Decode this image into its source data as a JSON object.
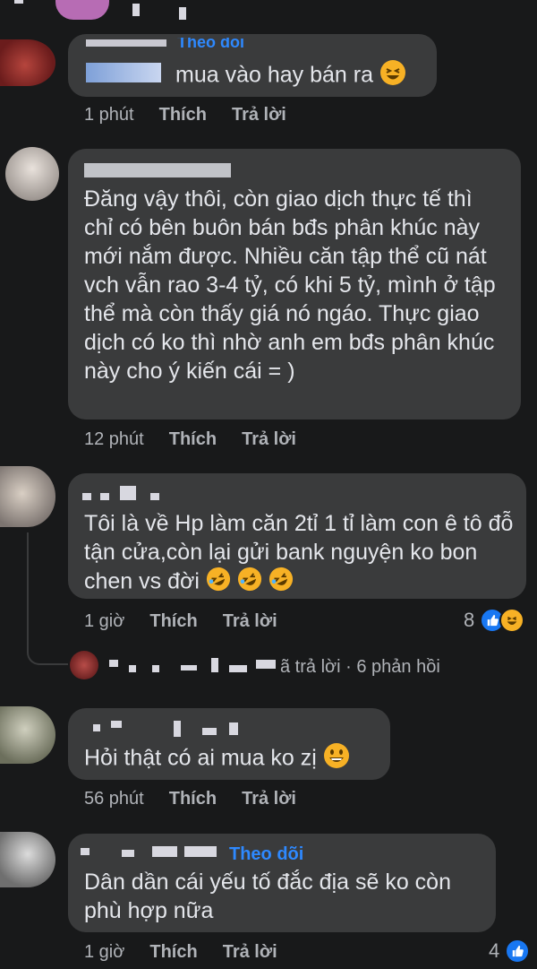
{
  "comments": [
    {
      "body_visible": "mua vào hay bán ra",
      "follow_label": "Theo dõi",
      "time": "1 phút",
      "like_label": "Thích",
      "reply_label": "Trả lời"
    },
    {
      "body": "Đăng vậy thôi, còn giao dịch thực tế thì chỉ có bên buôn bán bđs phân khúc này mới nắm được. Nhiều căn tập thể cũ nát vch vẫn rao 3-4 tỷ, có khi 5 tỷ, mình ở tập thể mà còn thấy giá nó ngáo. Thực giao dịch có ko thì nhờ anh em bđs phân khúc này cho ý kiến cái = )",
      "time": "12 phút",
      "like_label": "Thích",
      "reply_label": "Trả lời"
    },
    {
      "body": "Tôi là về Hp làm căn 2tỉ 1 tỉ làm con ê tô đỗ tận cửa,còn lại gửi bank nguyện ko bon chen vs đời",
      "time": "1 giờ",
      "like_label": "Thích",
      "reply_label": "Trả lời",
      "reaction_count": "8",
      "replies_summary": "ã trả lời · 6 phản hồi"
    },
    {
      "body": "Hỏi thật có ai mua ko zị",
      "time": "56 phút",
      "like_label": "Thích",
      "reply_label": "Trả lời"
    },
    {
      "follow_label": "Theo dõi",
      "body": "Dân dần cái yếu tố đắc địa sẽ ko còn phù hợp nữa",
      "time": "1 giờ",
      "like_label": "Thích",
      "reply_label": "Trả lời",
      "reaction_count": "4"
    }
  ],
  "colors": {
    "background": "#18191a",
    "bubble": "#3a3b3c",
    "text": "#e4e6eb",
    "muted": "#b0b3b8",
    "link": "#2e89ff",
    "like": "#1877f2"
  },
  "icons": [
    "like-icon",
    "haha-icon",
    "laughing-emoji",
    "rofl-emoji",
    "grin-emoji"
  ]
}
